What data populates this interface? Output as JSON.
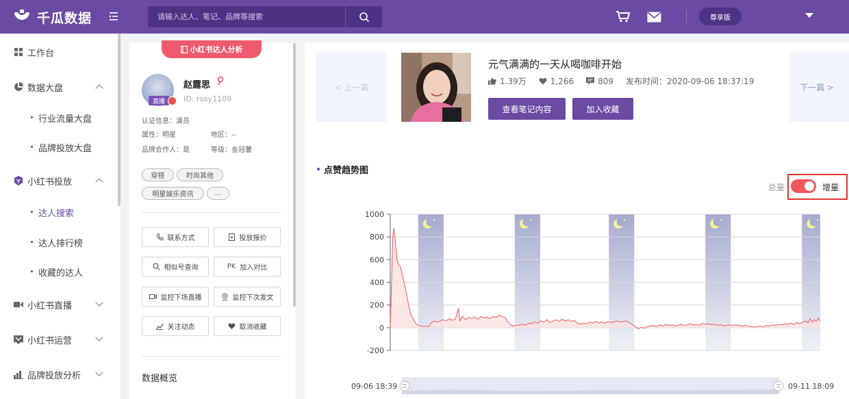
{
  "app": {
    "name": "千瓜数据",
    "tier": "尊享版"
  },
  "search": {
    "placeholder": "请输入达人、笔记、品牌等搜索"
  },
  "sidebar": {
    "items": [
      {
        "label": "工作台",
        "icon": "dashboard-icon"
      },
      {
        "label": "数据大盘",
        "icon": "pie-chart-icon",
        "expanded": true
      },
      {
        "label": "行业流量大盘"
      },
      {
        "label": "品牌投放大盘"
      },
      {
        "label": "小红书投放",
        "icon": "cube-icon",
        "expanded": true
      },
      {
        "label": "达人搜索",
        "active": true
      },
      {
        "label": "达人排行榜"
      },
      {
        "label": "收藏的达人"
      },
      {
        "label": "小红书直播",
        "icon": "video-icon",
        "expanded": false
      },
      {
        "label": "小红书运营",
        "icon": "chat-icon",
        "expanded": false
      },
      {
        "label": "品牌投放分析",
        "icon": "bar-chart-icon",
        "expanded": false
      }
    ]
  },
  "profile": {
    "tab_label": "小红书达人分析",
    "name": "赵露思",
    "id": "ID:  rosy1109",
    "live_badge": "直播",
    "cert": "认证信息：演员",
    "attr": "属性：明星",
    "region": "地区：--",
    "partner": "品牌合作人：是",
    "level": "等级：金冠薯",
    "tags": [
      "穿搭",
      "时尚其他",
      "明星娱乐资讯",
      "..."
    ],
    "actions": [
      "联系方式",
      "投放报价",
      "相似号查询",
      "加入对比",
      "监控下场直播",
      "监控下次发文",
      "关注动态",
      "取消收藏"
    ],
    "overview_title": "数据概览"
  },
  "post": {
    "prev_label": "< 上一篇",
    "next_label": "下一篇 >",
    "title": "元气满满的一天从喝咖啡开始",
    "likes": "1.39万",
    "favorites": "1,266",
    "comments": "809",
    "publish_time": "发布时间：2020-09-06 18:37:19",
    "view_button": "查看笔记内容",
    "fav_button": "加入收藏"
  },
  "trend": {
    "title": "点赞趋势图",
    "toggle_left": "总量",
    "toggle_right": "增量",
    "toggle_on": true
  },
  "chart_data": {
    "type": "area",
    "title": "",
    "ylim": [
      -200,
      1000
    ],
    "yticks": [
      "1000",
      "800",
      "600",
      "400",
      "200",
      "0",
      "-200"
    ],
    "range_start": "09-06 18:39",
    "range_end": "09-11 18:09",
    "night_band_icon": "moon-icon",
    "series": [
      {
        "color": "#f05b5b",
        "points": [
          [
            0,
            0
          ],
          [
            0.2,
            300
          ],
          [
            0.5,
            800
          ],
          [
            0.7,
            880
          ],
          [
            1,
            760
          ],
          [
            1.3,
            600
          ],
          [
            1.6,
            560
          ],
          [
            2,
            540
          ],
          [
            2.4,
            460
          ],
          [
            2.8,
            380
          ],
          [
            3.2,
            300
          ],
          [
            3.6,
            200
          ],
          [
            4,
            120
          ],
          [
            4.5,
            80
          ],
          [
            5,
            40
          ],
          [
            5.5,
            20
          ],
          [
            6,
            15
          ],
          [
            6.5,
            10
          ],
          [
            7,
            12
          ],
          [
            7.5,
            8
          ],
          [
            8,
            40
          ],
          [
            8.6,
            60
          ],
          [
            9.2,
            50
          ],
          [
            9.8,
            55
          ],
          [
            10.4,
            70
          ],
          [
            11,
            60
          ],
          [
            11.6,
            80
          ],
          [
            12.2,
            65
          ],
          [
            12.8,
            75
          ],
          [
            13.4,
            170
          ],
          [
            13.7,
            60
          ],
          [
            14.2,
            100
          ],
          [
            14.8,
            70
          ],
          [
            15.4,
            90
          ],
          [
            16,
            80
          ],
          [
            16.6,
            95
          ],
          [
            17.2,
            75
          ],
          [
            17.8,
            100
          ],
          [
            18.4,
            85
          ],
          [
            19,
            95
          ],
          [
            19.6,
            80
          ],
          [
            20.2,
            100
          ],
          [
            20.8,
            90
          ],
          [
            21.4,
            110
          ],
          [
            22,
            100
          ],
          [
            22.6,
            90
          ],
          [
            23,
            60
          ],
          [
            23.6,
            30
          ],
          [
            24.2,
            15
          ],
          [
            24.8,
            20
          ],
          [
            25.4,
            25
          ],
          [
            26,
            30
          ],
          [
            26.6,
            20
          ],
          [
            27.2,
            40
          ],
          [
            27.8,
            35
          ],
          [
            28.4,
            50
          ],
          [
            29,
            40
          ],
          [
            29.6,
            60
          ],
          [
            30.2,
            50
          ],
          [
            30.8,
            70
          ],
          [
            31.4,
            45
          ],
          [
            32,
            60
          ],
          [
            32.6,
            70
          ],
          [
            33.2,
            55
          ],
          [
            33.8,
            75
          ],
          [
            34.4,
            60
          ],
          [
            35,
            70
          ],
          [
            35.6,
            55
          ],
          [
            36.2,
            65
          ],
          [
            36.8,
            40
          ],
          [
            37.4,
            30
          ],
          [
            38,
            40
          ],
          [
            38.6,
            35
          ],
          [
            39.2,
            50
          ],
          [
            39.8,
            40
          ],
          [
            40.4,
            55
          ],
          [
            41,
            45
          ],
          [
            41.6,
            50
          ],
          [
            42.2,
            40
          ],
          [
            42.8,
            55
          ],
          [
            43.4,
            45
          ],
          [
            44,
            50
          ],
          [
            44.6,
            60
          ],
          [
            45.2,
            50
          ],
          [
            45.8,
            55
          ],
          [
            46.4,
            60
          ],
          [
            47,
            45
          ],
          [
            47.6,
            30
          ],
          [
            48.2,
            10
          ],
          [
            48.8,
            -10
          ],
          [
            49.4,
            5
          ],
          [
            50,
            -5
          ],
          [
            50.6,
            10
          ],
          [
            51.2,
            15
          ],
          [
            51.8,
            20
          ],
          [
            52.4,
            10
          ],
          [
            53,
            25
          ],
          [
            53.6,
            15
          ],
          [
            54.2,
            30
          ],
          [
            54.8,
            20
          ],
          [
            55.4,
            25
          ],
          [
            56,
            15
          ],
          [
            56.6,
            20
          ],
          [
            57.2,
            30
          ],
          [
            57.8,
            20
          ],
          [
            58.4,
            25
          ],
          [
            59,
            35
          ],
          [
            59.6,
            25
          ],
          [
            60.2,
            30
          ],
          [
            60.8,
            20
          ],
          [
            61.4,
            40
          ],
          [
            62,
            30
          ],
          [
            62.6,
            35
          ],
          [
            63.2,
            25
          ],
          [
            63.8,
            30
          ],
          [
            64.4,
            20
          ],
          [
            65,
            25
          ],
          [
            65.6,
            15
          ],
          [
            66.2,
            20
          ],
          [
            66.8,
            25
          ],
          [
            67.4,
            20
          ],
          [
            68,
            25
          ],
          [
            68.6,
            20
          ],
          [
            69.2,
            15
          ],
          [
            69.8,
            20
          ],
          [
            70.4,
            15
          ],
          [
            71,
            10
          ],
          [
            71.6,
            5
          ],
          [
            72.2,
            10
          ],
          [
            72.8,
            15
          ],
          [
            73.4,
            5
          ],
          [
            74,
            20
          ],
          [
            74.6,
            15
          ],
          [
            75.2,
            25
          ],
          [
            75.8,
            20
          ],
          [
            76.4,
            30
          ],
          [
            77,
            25
          ],
          [
            77.6,
            35
          ],
          [
            78.2,
            30
          ],
          [
            78.8,
            40
          ],
          [
            79.4,
            30
          ],
          [
            80,
            45
          ],
          [
            80.6,
            35
          ],
          [
            81.2,
            50
          ],
          [
            81.8,
            60
          ],
          [
            82.2,
            40
          ],
          [
            82.6,
            80
          ],
          [
            83,
            50
          ],
          [
            83.4,
            70
          ],
          [
            83.8,
            55
          ],
          [
            84.2,
            85
          ],
          [
            84.6,
            60
          ]
        ]
      }
    ],
    "x_max": 84.6,
    "night_bands": [
      [
        5.5,
        10.5
      ],
      [
        24.5,
        29.5
      ],
      [
        43,
        48
      ],
      [
        62,
        67
      ],
      [
        81,
        85.5
      ]
    ]
  }
}
